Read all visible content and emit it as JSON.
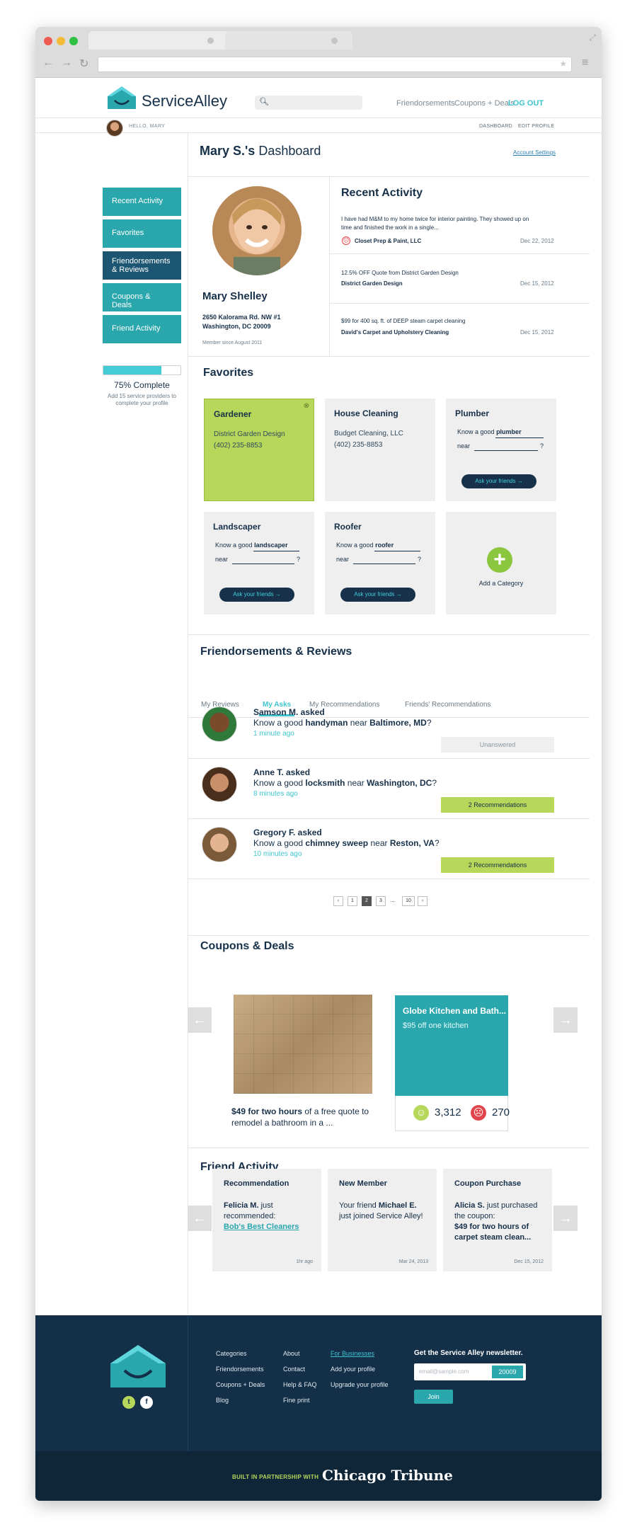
{
  "brand": {
    "name": "ServiceAlley",
    "accent": "#2aa6ad",
    "navy": "#143049",
    "lime": "#b6d75a"
  },
  "topnav": {
    "friendorsements": "Friendorsements",
    "coupons": "Coupons + Deals",
    "logout": "LOG OUT"
  },
  "subbar": {
    "hello": "HELLO, MARY",
    "dashboard": "DASHBOARD",
    "edit_profile": "EDIT PROFILE"
  },
  "sidebar": {
    "items": [
      {
        "label": "Recent Activity"
      },
      {
        "label": "Favorites"
      },
      {
        "label": "Friendorsements & Reviews"
      },
      {
        "label": "Coupons & Deals"
      },
      {
        "label": "Friend Activity"
      }
    ],
    "progress": 0.75,
    "complete_label": "75% Complete",
    "complete_hint": "Add 15 service providers to complete your profile"
  },
  "dashboard": {
    "owner": "Mary S.'s",
    "title": "Dashboard",
    "account_settings": "Account Settings"
  },
  "profile": {
    "name": "Mary Shelley",
    "address1": "2650 Kalorama Rd. NW #1",
    "address2": "Washington, DC 20009",
    "since": "Member since August 2011"
  },
  "recent": {
    "title": "Recent Activity",
    "items": [
      {
        "text": "I have had M&M to my home twice for interior painting. They showed up on time and finished the work in a single...",
        "who": "Closet Prep & Paint, LLC",
        "date": "Dec 22, 2012"
      },
      {
        "text": "12.5% OFF Quote from District Garden Design",
        "who": "District Garden Design",
        "date": "Dec 15, 2012"
      },
      {
        "text": "$99 for 400 sq. ft. of DEEP steam carpet cleaning",
        "who": "David's Carpet and Upholstery Cleaning",
        "date": "Dec 15, 2012"
      }
    ]
  },
  "favorites": {
    "title": "Favorites",
    "cards": [
      {
        "title": "Gardener",
        "line1": "District Garden Design",
        "line2": "(402) 235-8853"
      },
      {
        "title": "House Cleaning",
        "line1": "Budget Cleaning, LLC",
        "line2": "(402) 235-8853"
      },
      {
        "title": "Plumber",
        "q_prefix": "Know a good",
        "q_word": "plumber",
        "near": "near",
        "qmark": "?",
        "button": "Ask your friends"
      },
      {
        "title": "Landscaper",
        "q_prefix": "Know a good",
        "q_word": "landscaper",
        "near": "near",
        "qmark": "?",
        "button": "Ask your friends"
      },
      {
        "title": "Roofer",
        "q_prefix": "Know a good",
        "q_word": "roofer",
        "near": "near",
        "qmark": "?",
        "button": "Ask your friends"
      },
      {
        "title": "Add a Category"
      }
    ]
  },
  "friendorsements": {
    "title": "Friendorsements & Reviews",
    "tabs": [
      "My Reviews",
      "My Asks",
      "My Recommendations",
      "Friends' Recommendations"
    ],
    "asks": [
      {
        "name": "Samson M. asked",
        "q1": "Know a good",
        "service": "handyman",
        "near": "near",
        "place": "Baltimore, MD",
        "qmark": "?",
        "time": "1 minute ago",
        "status": "Unanswered"
      },
      {
        "name": "Anne T. asked",
        "q1": "Know a good",
        "service": "locksmith",
        "near": "near",
        "place": "Washington, DC",
        "qmark": "?",
        "time": "8 minutes ago",
        "status": "2 Recommendations"
      },
      {
        "name": "Gregory F. asked",
        "q1": "Know a good",
        "service": "chimney sweep",
        "near": "near",
        "place": "Reston, VA",
        "qmark": "?",
        "time": "10 minutes ago",
        "status": "2 Recommendations"
      }
    ],
    "pages": [
      "‹",
      "1",
      "2",
      "3",
      "...",
      "10",
      "›"
    ]
  },
  "coupons": {
    "title": "Coupons & Deals",
    "deal1_bold": "$49 for two hours",
    "deal1_rest": " of a free quote to remodel a bathroom in a ...",
    "deal2_title": "Globe Kitchen and Bath...",
    "deal2_sub": "$95 off one kitchen",
    "likes": "3,312",
    "dislikes": "270"
  },
  "friend_activity": {
    "title": "Friend Activity",
    "cards": [
      {
        "title": "Recommendation",
        "who": "Felicia M.",
        "text": " just recommended:",
        "link": "Bob's Best Cleaners",
        "date": "1hr ago"
      },
      {
        "title": "New Member",
        "pre": "Your friend ",
        "who": "Michael E.",
        "text": " just joined Service Alley!",
        "date": "Mar 24, 2013"
      },
      {
        "title": "Coupon Purchase",
        "who": "Alicia S.",
        "text": " just purchased the coupon:",
        "deal": "$49 for two hours of carpet steam clean...",
        "date": "Dec 15, 2012"
      }
    ]
  },
  "footer": {
    "col1": [
      "Categories",
      "Friendorsements",
      "Coupons + Deals",
      "Blog"
    ],
    "col2": [
      "About",
      "Contact",
      "Help & FAQ",
      "Fine print"
    ],
    "col3": [
      "For Businesses",
      "Add your profile",
      "Upgrade your profile"
    ],
    "newsletter_title": "Get the Service Alley newsletter.",
    "email_placeholder": "email@sample.com",
    "zip": "20009",
    "join": "Join",
    "built": "BUILT IN PARTNERSHIP WITH",
    "partner": "Chicago Tribune"
  }
}
